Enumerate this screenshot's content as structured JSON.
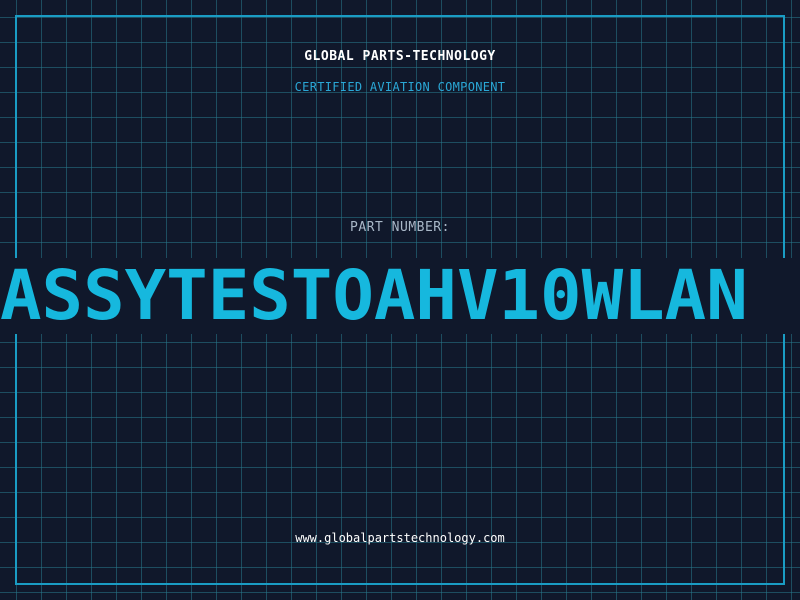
{
  "header": {
    "company": "GLOBAL PARTS-TECHNOLOGY",
    "subtitle": "CERTIFIED AVIATION COMPONENT"
  },
  "part": {
    "label": "PART NUMBER:",
    "number": "ASSYTESTOAHV10WLAN"
  },
  "footer": {
    "website": "www.globalpartstechnology.com"
  },
  "colors": {
    "background": "#10182b",
    "accent": "#1a9cc4",
    "grid": "#287888",
    "part_number": "#16b8de",
    "text_primary": "#ffffff",
    "text_secondary": "#a9b8c8"
  }
}
